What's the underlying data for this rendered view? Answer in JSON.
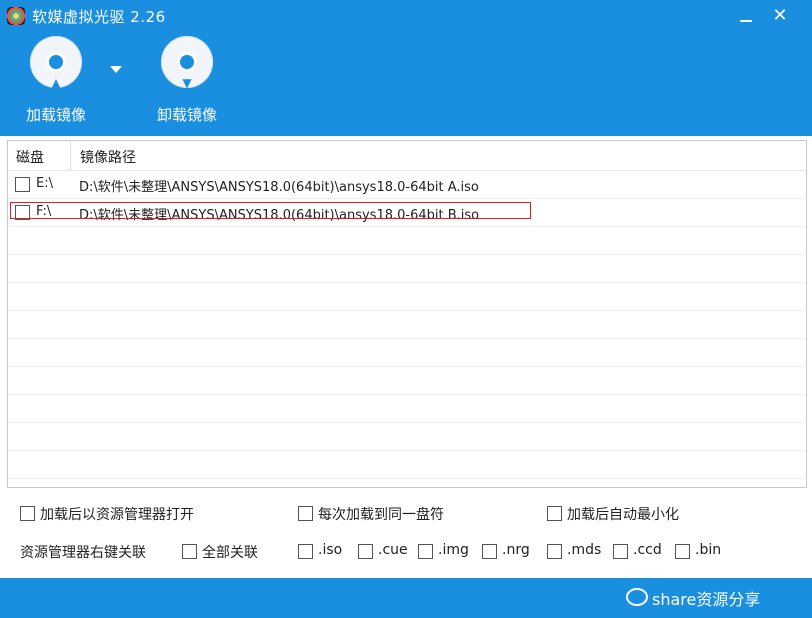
{
  "window": {
    "title": "软媒虚拟光驱 2.26",
    "minimize": "—",
    "close": "✕"
  },
  "toolbar": {
    "mount_label": "加载镜像",
    "unmount_label": "卸载镜像",
    "mount_icon": "disc-up-arrow-icon",
    "unmount_icon": "disc-down-arrow-icon",
    "dropdown_icon": "chevron-down-icon"
  },
  "table": {
    "columns": [
      "磁盘",
      "镜像路径"
    ],
    "rows": [
      {
        "drive": "E:\\",
        "path": "D:\\软件\\未整理\\ANSYS\\ANSYS18.0(64bit)\\ansys18.0-64bit A.iso",
        "checked": false
      },
      {
        "drive": "F:\\",
        "path": "D:\\软件\\未整理\\ANSYS\\ANSYS18.0(64bit)\\ansys18.0-64bit B.iso",
        "checked": false,
        "highlighted": true
      }
    ]
  },
  "options": {
    "open_explorer": "加载后以资源管理器打开",
    "same_drive": "每次加载到同一盘符",
    "auto_minimize": "加载后自动最小化",
    "assoc_label": "资源管理器右键关联",
    "all_assoc": "全部关联",
    "extensions": [
      ".iso",
      ".cue",
      ".img",
      ".nrg",
      ".mds",
      ".ccd",
      ".bin"
    ]
  },
  "watermark": {
    "text": "share资源分享"
  },
  "colors": {
    "accent": "#1a8fe0",
    "highlight": "#e02020"
  }
}
